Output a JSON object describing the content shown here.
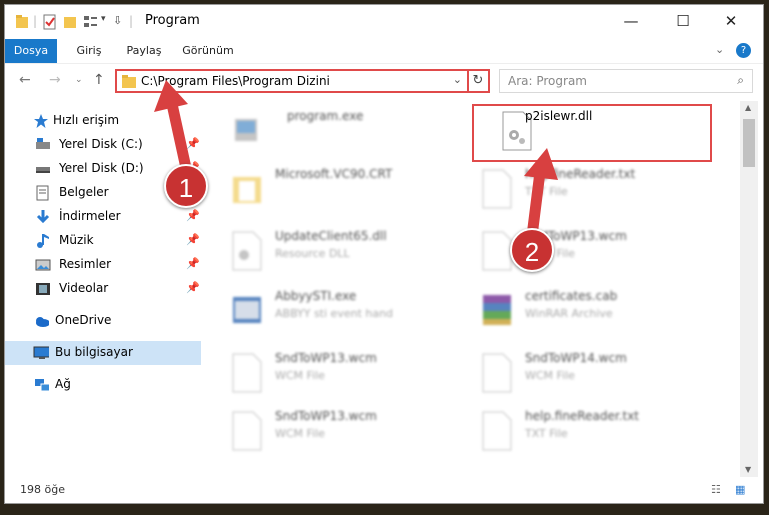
{
  "window": {
    "title": "Program"
  },
  "ribbon": {
    "tabs": [
      "Dosya",
      "Giriş",
      "Paylaş",
      "Görünüm"
    ]
  },
  "address": {
    "path": "C:\\Program Files\\Program Dizini",
    "search_placeholder": "Ara: Program"
  },
  "sidebar": {
    "items": [
      {
        "label": "Hızlı erişim",
        "icon": "star-icon"
      },
      {
        "label": "Yerel Disk (C:)",
        "icon": "drive-icon"
      },
      {
        "label": "Yerel Disk (D:)",
        "icon": "drive-icon"
      },
      {
        "label": "Belgeler",
        "icon": "document-icon"
      },
      {
        "label": "İndirmeler",
        "icon": "download-icon"
      },
      {
        "label": "Müzik",
        "icon": "music-icon"
      },
      {
        "label": "Resimler",
        "icon": "pictures-icon"
      },
      {
        "label": "Videolar",
        "icon": "video-icon"
      },
      {
        "label": "OneDrive",
        "icon": "cloud-icon"
      },
      {
        "label": "Bu bilgisayar",
        "icon": "computer-icon"
      },
      {
        "label": "Ağ",
        "icon": "network-icon"
      }
    ]
  },
  "files": [
    {
      "name": "program.exe",
      "type": ""
    },
    {
      "name": "p2islewr.dll",
      "type": ""
    },
    {
      "name": "Microsoft.VC90.CRT",
      "type": ""
    },
    {
      "name": "helpfineReader.txt",
      "type": "TXT File"
    },
    {
      "name": "UpdateClient65.dll",
      "type": "Resource DLL"
    },
    {
      "name": "SndToWP13.wcm",
      "type": "WCM File"
    },
    {
      "name": "AbbyySTI.exe",
      "type": "ABBYY sti event hand"
    },
    {
      "name": "certificates.cab",
      "type": "WinRAR Archive"
    },
    {
      "name": "SndToWP13.wcm",
      "type": "WCM File"
    },
    {
      "name": "SndToWP14.wcm",
      "type": "WCM File"
    },
    {
      "name": "SndToWP13.wcm",
      "type": "WCM File"
    },
    {
      "name": "help.fineReader.txt",
      "type": "TXT File"
    }
  ],
  "status": {
    "count": "198 öğe"
  },
  "annotations": {
    "step1": "1",
    "step2": "2"
  },
  "colors": {
    "accent": "#1979ca",
    "highlight": "#e04a4a",
    "selected": "#cde3f7"
  }
}
